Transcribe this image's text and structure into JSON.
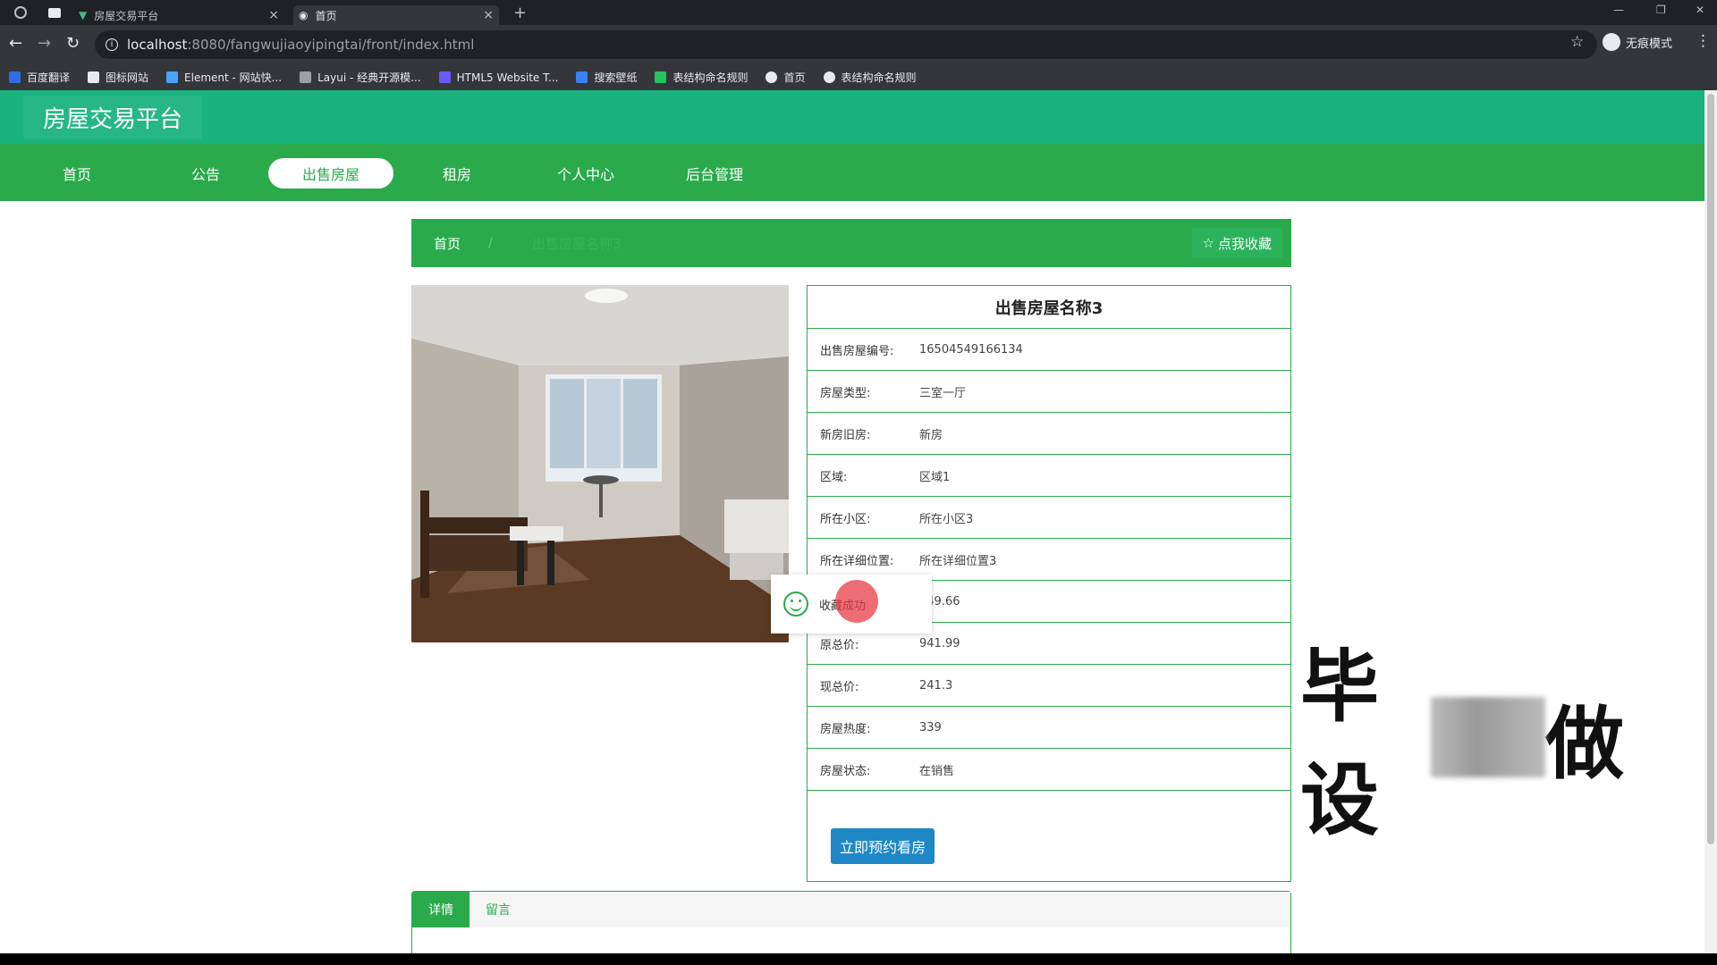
{
  "browser": {
    "tabs": [
      {
        "label": "房屋交易平台"
      },
      {
        "label": "首页"
      }
    ],
    "url_host": "localhost",
    "url_path": ":8080/fangwujiaoyipingtai/front/index.html",
    "incognito_label": "无痕模式",
    "bookmarks": [
      {
        "label": "百度翻译",
        "color": "#2f6fe4"
      },
      {
        "label": "图标网站",
        "color": "#e8eaed"
      },
      {
        "label": "Element - 网站快...",
        "color": "#4aa3ff"
      },
      {
        "label": "Layui - 经典开源模...",
        "color": "#9aa0a6"
      },
      {
        "label": "HTML5 Website T...",
        "color": "#6a5af9"
      },
      {
        "label": "搜索壁纸",
        "color": "#3b82f6"
      },
      {
        "label": "表结构命名规则",
        "color": "#22c55e"
      },
      {
        "label": "首页",
        "color": "#e8eaed"
      },
      {
        "label": "表结构命名规则",
        "color": "#e8eaed"
      }
    ]
  },
  "site": {
    "logo": "房屋交易平台",
    "nav": [
      {
        "label": "首页"
      },
      {
        "label": "公告"
      },
      {
        "label": "出售房屋"
      },
      {
        "label": "租房"
      },
      {
        "label": "个人中心"
      },
      {
        "label": "后台管理"
      }
    ],
    "active_nav": "出售房屋",
    "brand_color": "#2aaa4b"
  },
  "breadcrumb": {
    "home": "首页",
    "separator": "/",
    "current": "出售房屋名称3",
    "favorite_label": "点我收藏"
  },
  "house": {
    "title": "出售房屋名称3",
    "fields": [
      {
        "label": "出售房屋编号:",
        "value": "16504549166134"
      },
      {
        "label": "房屋类型:",
        "value": "三室一厅"
      },
      {
        "label": "新房旧房:",
        "value": "新房"
      },
      {
        "label": "区域:",
        "value": "区域1"
      },
      {
        "label": "所在小区:",
        "value": "所在小区3"
      },
      {
        "label": "所在详细位置:",
        "value": "所在详细位置3"
      },
      {
        "label": "",
        "value": "849.66"
      },
      {
        "label": "原总价:",
        "value": "941.99"
      },
      {
        "label": "现总价:",
        "value": "241.3"
      },
      {
        "label": "房屋热度:",
        "value": "339"
      },
      {
        "label": "房屋状态:",
        "value": "在销售"
      }
    ],
    "book_button": "立即预约看房"
  },
  "toast": {
    "message": "收藏成功"
  },
  "detail_tabs": [
    {
      "label": "详情"
    },
    {
      "label": "留言"
    }
  ],
  "watermark": {
    "prefix": "毕设",
    "suffix": "做"
  }
}
